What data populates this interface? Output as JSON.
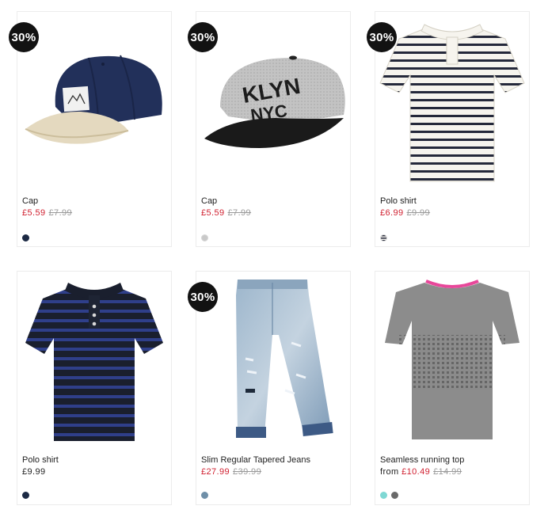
{
  "products": [
    {
      "badge": "30%",
      "name": "Cap",
      "price_prefix": "",
      "price": "£5.59",
      "old_price": "£7.99",
      "on_sale": true,
      "image_icon": "navy-cap-image",
      "swatches": [
        "#1c2a44"
      ]
    },
    {
      "badge": "30%",
      "name": "Cap",
      "price_prefix": "",
      "price": "£5.59",
      "old_price": "£7.99",
      "on_sale": true,
      "image_icon": "grey-brooklyn-cap-image",
      "swatches": [
        "#c9c9c9"
      ]
    },
    {
      "badge": "30%",
      "name": "Polo shirt",
      "price_prefix": "",
      "price": "£6.99",
      "old_price": "£9.99",
      "on_sale": true,
      "image_icon": "striped-white-polo-image",
      "swatches": [
        "striped"
      ]
    },
    {
      "badge": "",
      "name": "Polo shirt",
      "price_prefix": "",
      "price": "£9.99",
      "old_price": "",
      "on_sale": false,
      "image_icon": "striped-navy-polo-image",
      "swatches": [
        "#1c2a44"
      ]
    },
    {
      "badge": "30%",
      "name": "Slim Regular Tapered Jeans",
      "price_prefix": "",
      "price": "£27.99",
      "old_price": "£39.99",
      "on_sale": true,
      "image_icon": "distressed-jeans-image",
      "swatches": [
        "#6f8fa8"
      ]
    },
    {
      "badge": "",
      "name": "Seamless running top",
      "price_prefix": "from",
      "price": "£10.49",
      "old_price": "£14.99",
      "on_sale": true,
      "image_icon": "grey-running-top-image",
      "swatches": [
        "#7fd8d4",
        "#6a6a6a"
      ]
    }
  ],
  "colors": {
    "sale_price": "#d01f2f",
    "badge_bg": "#121212",
    "old_price": "#999999"
  }
}
